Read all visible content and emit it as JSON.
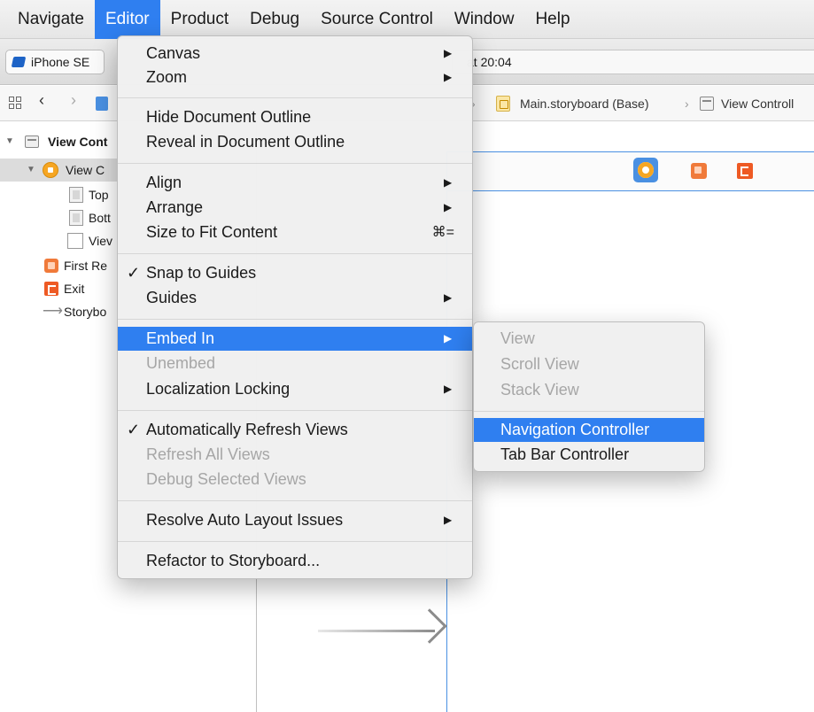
{
  "menubar": {
    "items": [
      "Navigate",
      "Editor",
      "Product",
      "Debug",
      "Source Control",
      "Window",
      "Help"
    ],
    "active": "Editor"
  },
  "toolbar": {
    "scheme_label": "iPhone SE",
    "status_text": "at 20:04"
  },
  "jumpbar": {
    "storyboard": "Main.storyboard (Base)",
    "view_controller": "View Controll"
  },
  "outline": {
    "scene": "View Cont",
    "view_controller": "View C",
    "top_guide": "Top",
    "bottom_guide": "Bott",
    "view": "Viev",
    "first_responder": "First Re",
    "exit": "Exit",
    "entry": "Storybo"
  },
  "menu": {
    "canvas": "Canvas",
    "zoom": "Zoom",
    "hide_outline": "Hide Document Outline",
    "reveal_outline": "Reveal in Document Outline",
    "align": "Align",
    "arrange": "Arrange",
    "size_to_fit": "Size to Fit Content",
    "size_to_fit_shortcut": "⌘=",
    "snap_to_guides": "Snap to Guides",
    "guides": "Guides",
    "embed_in": "Embed In",
    "unembed": "Unembed",
    "localization_locking": "Localization Locking",
    "auto_refresh": "Automatically Refresh Views",
    "refresh_all": "Refresh All Views",
    "debug_selected": "Debug Selected Views",
    "resolve_auto_layout": "Resolve Auto Layout Issues",
    "refactor": "Refactor to Storyboard..."
  },
  "submenu": {
    "view": "View",
    "scroll_view": "Scroll View",
    "stack_view": "Stack View",
    "navigation_controller": "Navigation Controller",
    "tab_bar_controller": "Tab Bar Controller"
  },
  "glyphs": {
    "check": "✓",
    "submenu_arrow": "▶",
    "disclosure_open": "▼",
    "entry_arrow": "⟶",
    "back": "‹",
    "forward": "›",
    "path_sep": "›"
  },
  "colors": {
    "highlight": "#2f7ff0",
    "disabled_text": "#a6a6a6",
    "canvas_guide": "#4a90e2"
  }
}
